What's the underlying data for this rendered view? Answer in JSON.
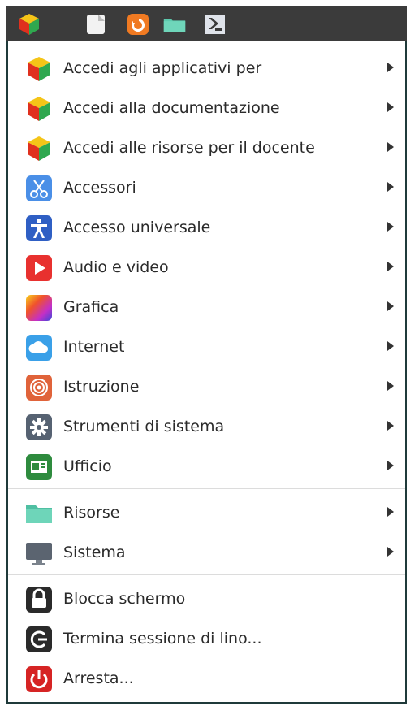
{
  "taskbar": {
    "icons": [
      "app-menu-icon",
      "text-editor-icon",
      "firefox-icon",
      "folder-icon",
      "terminal-icon"
    ]
  },
  "menu": {
    "categories": [
      {
        "label": "Accedi agli applicativi per",
        "icon": "school-cube-icon"
      },
      {
        "label": "Accedi alla documentazione",
        "icon": "school-cube-icon"
      },
      {
        "label": "Accedi alle risorse per il docente",
        "icon": "school-cube-icon"
      },
      {
        "label": "Accessori",
        "icon": "scissors-icon"
      },
      {
        "label": "Accesso universale",
        "icon": "accessibility-icon"
      },
      {
        "label": "Audio e video",
        "icon": "play-icon"
      },
      {
        "label": "Grafica",
        "icon": "graphics-icon"
      },
      {
        "label": "Internet",
        "icon": "cloud-icon"
      },
      {
        "label": "Istruzione",
        "icon": "education-icon"
      },
      {
        "label": "Strumenti di sistema",
        "icon": "gear-icon"
      },
      {
        "label": "Ufficio",
        "icon": "office-icon"
      }
    ],
    "places": [
      {
        "label": "Risorse",
        "icon": "folder-icon"
      },
      {
        "label": "Sistema",
        "icon": "monitor-icon"
      }
    ],
    "session": [
      {
        "label": "Blocca schermo",
        "icon": "lock-icon"
      },
      {
        "label": "Termina sessione di lino...",
        "icon": "logout-icon"
      },
      {
        "label": "Arresta...",
        "icon": "power-icon"
      }
    ]
  },
  "colors": {
    "taskbar": "#3b3b3b",
    "border": "#1f3a3a",
    "text": "#2a2a2a"
  }
}
